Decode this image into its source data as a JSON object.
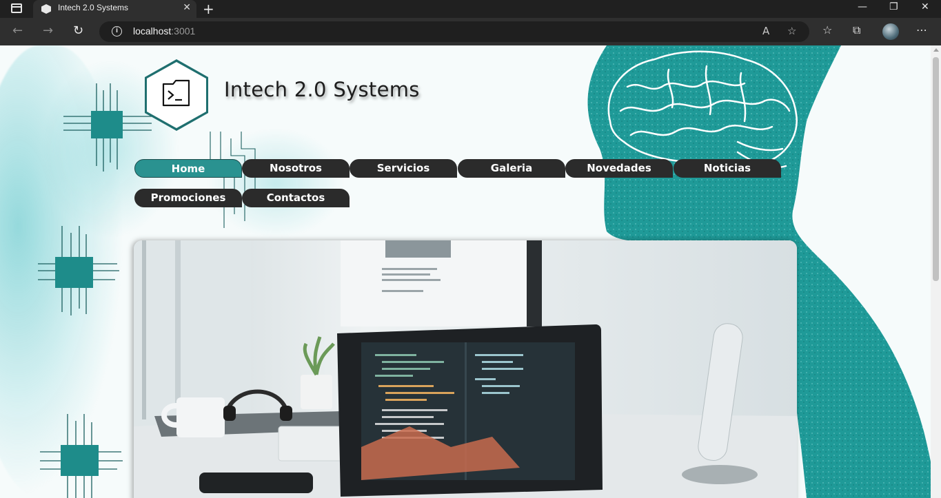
{
  "browser": {
    "tab_title": "Intech 2.0 Systems",
    "url_host": "localhost",
    "url_port": ":3001",
    "icons": [
      "tab-actions-icon",
      "site-favicon",
      "close-icon",
      "new-tab-icon",
      "minimize-icon",
      "restore-icon",
      "window-close-icon",
      "back-icon",
      "forward-icon",
      "refresh-icon",
      "info-icon",
      "read-aloud-icon",
      "add-favorite-icon",
      "favorites-icon",
      "collections-icon",
      "profile-avatar",
      "more-icon"
    ]
  },
  "site": {
    "title": "Intech 2.0 Systems",
    "logo_icon": "terminal-folder-icon"
  },
  "nav": {
    "items": [
      {
        "label": "Home",
        "active": true
      },
      {
        "label": "Nosotros",
        "active": false
      },
      {
        "label": "Servicios",
        "active": false
      },
      {
        "label": "Galeria",
        "active": false
      },
      {
        "label": "Novedades",
        "active": false
      },
      {
        "label": "Noticias",
        "active": false
      },
      {
        "label": "Promociones",
        "active": false
      },
      {
        "label": "Contactos",
        "active": false
      }
    ]
  },
  "hero": {
    "image": "laptop-with-code-on-desk-photo"
  },
  "colors": {
    "accent": "#2a9290",
    "nav_bg": "#2b2b2b",
    "teal_decor": "#1f9a98"
  }
}
